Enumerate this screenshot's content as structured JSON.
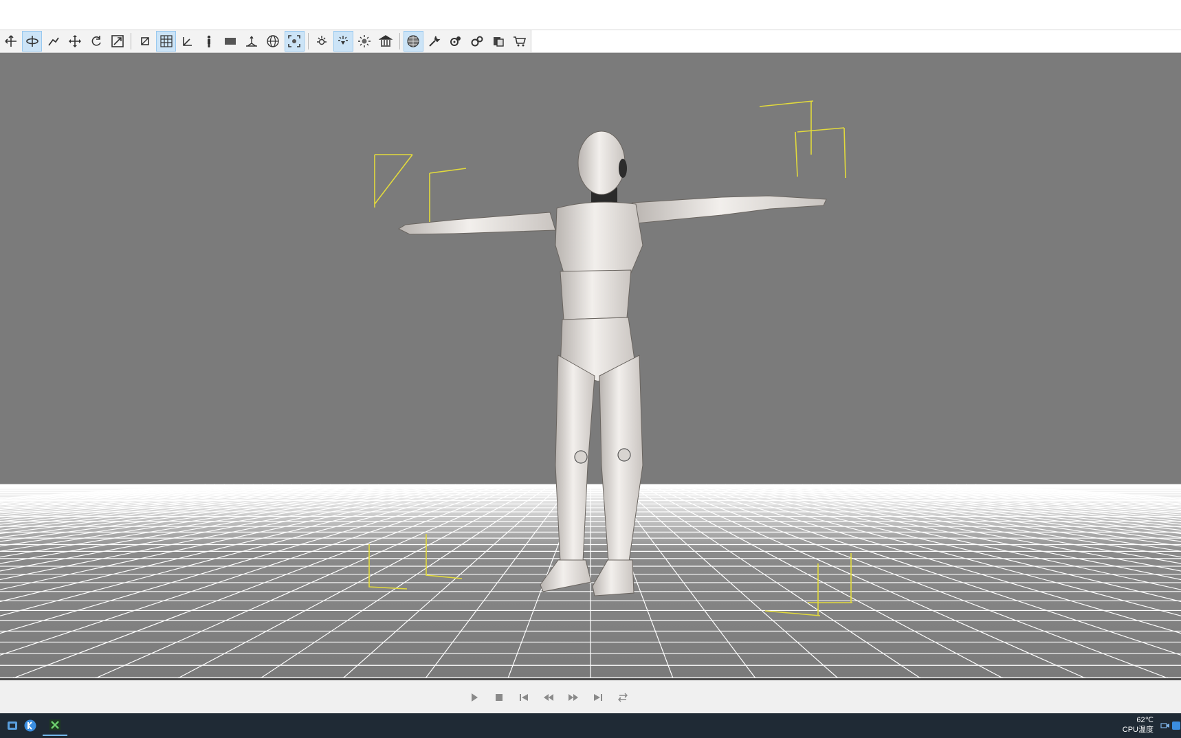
{
  "toolbar": {
    "buttons": [
      {
        "icon": "translate-icon",
        "active": false
      },
      {
        "icon": "orbit-icon",
        "active": true
      },
      {
        "icon": "bone-select-icon",
        "active": false
      },
      {
        "icon": "move-icon",
        "active": false
      },
      {
        "icon": "rotate-icon",
        "active": false
      },
      {
        "icon": "scale-icon",
        "active": false
      },
      {
        "icon": "frame-icon",
        "active": false
      },
      {
        "icon": "grid-icon",
        "active": true
      },
      {
        "icon": "axis-icon",
        "active": false
      },
      {
        "icon": "figure-icon",
        "active": false
      },
      {
        "icon": "plane-icon",
        "active": false
      },
      {
        "icon": "ground-icon",
        "active": false
      },
      {
        "icon": "globe-icon",
        "active": false
      },
      {
        "icon": "focus-icon",
        "active": true
      },
      {
        "icon": "light-point-icon",
        "active": false
      },
      {
        "icon": "light-spot-icon",
        "active": true
      },
      {
        "icon": "light-sun-icon",
        "active": false
      },
      {
        "icon": "museum-icon",
        "active": false
      },
      {
        "icon": "sphere-grid-icon",
        "active": true
      },
      {
        "icon": "wrench-icon",
        "active": false
      },
      {
        "icon": "settings-gear-icon",
        "active": false
      },
      {
        "icon": "gear-pair-icon",
        "active": false
      },
      {
        "icon": "export-icon",
        "active": false
      },
      {
        "icon": "cart-icon",
        "active": false
      }
    ]
  },
  "viewport": {
    "background": "#7a7a7a",
    "grid_color": "#ffffff",
    "light_marker_color": "#e8e04a"
  },
  "playback": {
    "controls": [
      "play-icon",
      "stop-icon",
      "skip-start-icon",
      "step-back-icon",
      "step-forward-icon",
      "skip-end-icon",
      "loop-icon"
    ]
  },
  "taskbar": {
    "apps": [
      "start-icon",
      "k-app-icon",
      "x-app-icon"
    ],
    "tray": {
      "temperature": "62℃",
      "temperature_label": "CPU温度"
    }
  }
}
